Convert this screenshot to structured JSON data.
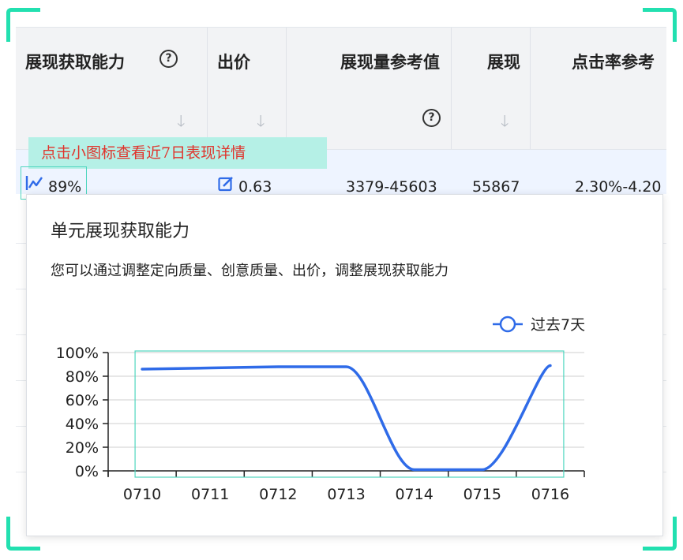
{
  "table": {
    "columns": [
      {
        "label": "展现获取能力",
        "help": "?"
      },
      {
        "label": "出价"
      },
      {
        "label": "展现量参考值",
        "help": "?"
      },
      {
        "label": "展现"
      },
      {
        "label": "点击率参考"
      }
    ],
    "hint_text": "点击小图标查看近7日表现详情",
    "row": {
      "capability": "89%",
      "bid": "0.63",
      "impression_ref": "3379-45603",
      "impressions": "55867",
      "ctr_ref": "2.30%-4.20"
    }
  },
  "popover": {
    "title": "单元展现获取能力",
    "description": "您可以通过调整定向质量、创意质量、出价，调整展现获取能力"
  },
  "colors": {
    "accent": "#22e0b0",
    "series": "#2f6be8",
    "hint_bg": "#b5f0e6",
    "hint_text": "#e0342c",
    "header_bg": "#f2f3f5",
    "row_bg": "#eef4ff"
  },
  "chart_data": {
    "type": "line",
    "categories": [
      "0710",
      "0711",
      "0712",
      "0713",
      "0714",
      "0715",
      "0716"
    ],
    "series": [
      {
        "name": "过去7天",
        "values": [
          86,
          87,
          88,
          88,
          1,
          1,
          89
        ]
      }
    ],
    "ylim": [
      0,
      100
    ],
    "yticks": [
      "0%",
      "20%",
      "40%",
      "60%",
      "80%",
      "100%"
    ],
    "grid": true,
    "legend": "top-right"
  }
}
